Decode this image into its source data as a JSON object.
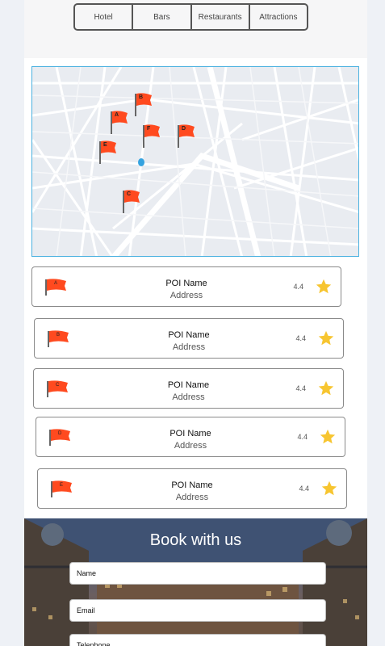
{
  "tabs": [
    "Hotel",
    "Bars",
    "Restaurants",
    "Attractions"
  ],
  "map": {
    "pins": [
      "A",
      "B",
      "C",
      "D",
      "E",
      "F"
    ],
    "flag_color": "#ff4a1f",
    "location_color": "#35a3e0"
  },
  "poi_list": [
    {
      "flag": "A",
      "name": "POI Name",
      "address": "Address",
      "rating": "4.4"
    },
    {
      "flag": "B",
      "name": "POI Name",
      "address": "Address",
      "rating": "4.4"
    },
    {
      "flag": "C",
      "name": "POI Name",
      "address": "Address",
      "rating": "4.4"
    },
    {
      "flag": "D",
      "name": "POI Name",
      "address": "Address",
      "rating": "4.4"
    },
    {
      "flag": "E",
      "name": "POI Name",
      "address": "Address",
      "rating": "4.4"
    }
  ],
  "star_color": "#f7c530",
  "booking": {
    "title": "Book with us",
    "name_placeholder": "Name",
    "email_placeholder": "Email",
    "telephone_placeholder": "Telephone"
  }
}
